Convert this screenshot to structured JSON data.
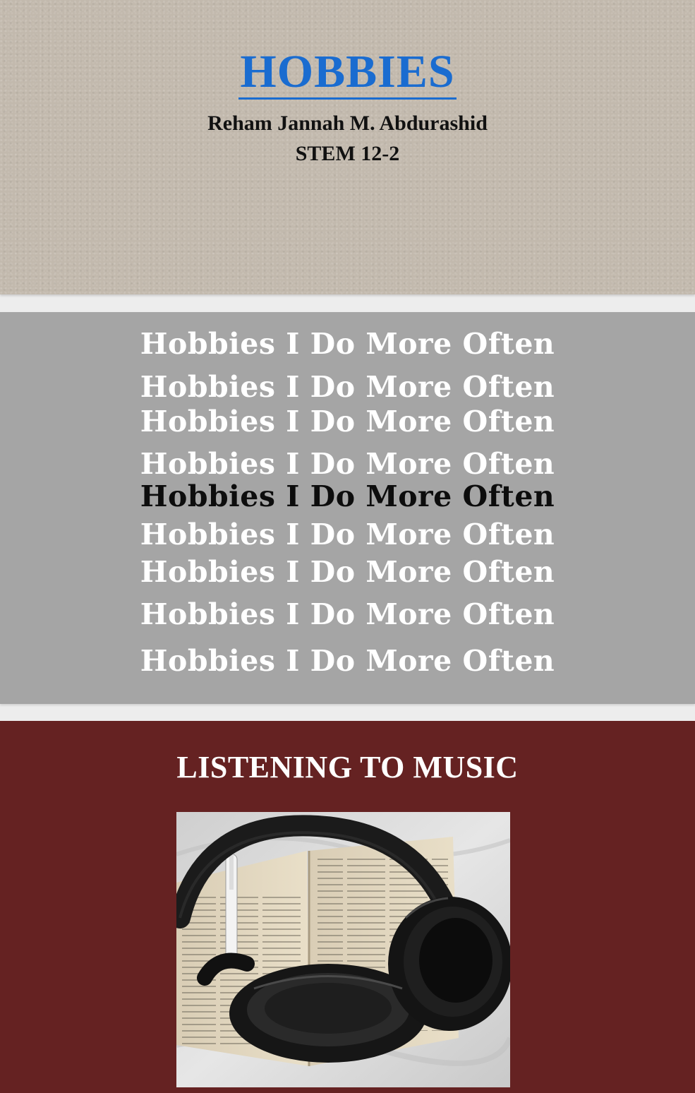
{
  "slide1": {
    "title": "HOBBIES",
    "author": "Reham Jannah M. Abdurashid",
    "section": "STEM 12-2"
  },
  "slide2": {
    "lines": [
      {
        "text": "Hobbies I Do More Often",
        "style": "light"
      },
      {
        "text": "Hobbies I Do More Often",
        "style": "light"
      },
      {
        "text": "Hobbies I Do More Often",
        "style": "light"
      },
      {
        "text": "Hobbies I Do More Often",
        "style": "light"
      },
      {
        "text": "Hobbies I Do More Often",
        "style": "dark"
      },
      {
        "text": "Hobbies I Do More Often",
        "style": "light"
      },
      {
        "text": "Hobbies I Do More Often",
        "style": "light"
      },
      {
        "text": "Hobbies I Do More Often",
        "style": "light"
      },
      {
        "text": "Hobbies I Do More Often",
        "style": "light"
      }
    ]
  },
  "slide3": {
    "title": "LISTENING TO MUSIC",
    "image": "headphones-on-open-book-photo"
  },
  "colors": {
    "title_blue": "#1a6cd0",
    "slide1_bg": "#c2b9ad",
    "slide2_bg": "#a5a5a5",
    "slide3_bg": "#652222"
  }
}
